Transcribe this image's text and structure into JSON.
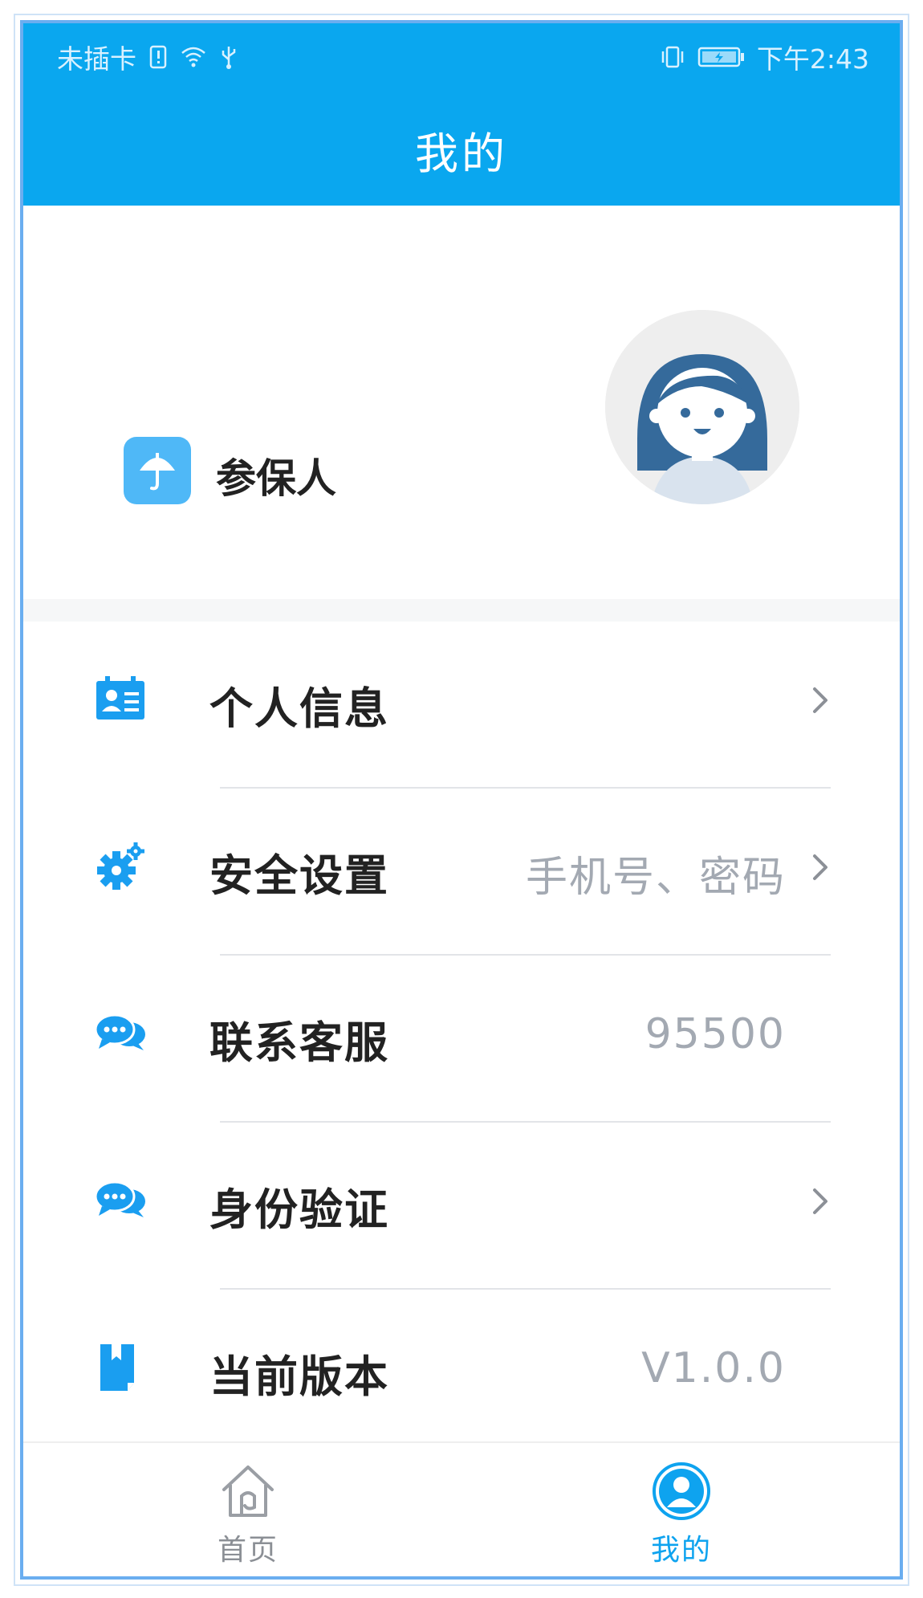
{
  "statusbar": {
    "carrier": "未插卡",
    "time": "下午2:43"
  },
  "header": {
    "title": "我的"
  },
  "profile": {
    "role_label": "参保人"
  },
  "menu": {
    "items": [
      {
        "label": "个人信息",
        "value": "",
        "icon": "id-card-icon",
        "chevron": true
      },
      {
        "label": "安全设置",
        "value": "手机号、密码",
        "icon": "gear-icon",
        "chevron": true
      },
      {
        "label": "联系客服",
        "value": "95500",
        "icon": "chat-icon",
        "chevron": false
      },
      {
        "label": "身份验证",
        "value": "",
        "icon": "chat-icon",
        "chevron": true
      },
      {
        "label": "当前版本",
        "value": "V1.0.0",
        "icon": "book-icon",
        "chevron": false
      }
    ]
  },
  "tabbar": {
    "tabs": [
      {
        "label": "首页",
        "icon": "home-icon",
        "active": false
      },
      {
        "label": "我的",
        "icon": "user-icon",
        "active": true
      }
    ]
  },
  "colors": {
    "brand": "#0aa7ef",
    "accent_icon": "#1a9ef0",
    "muted_text": "#a3a9b2"
  }
}
